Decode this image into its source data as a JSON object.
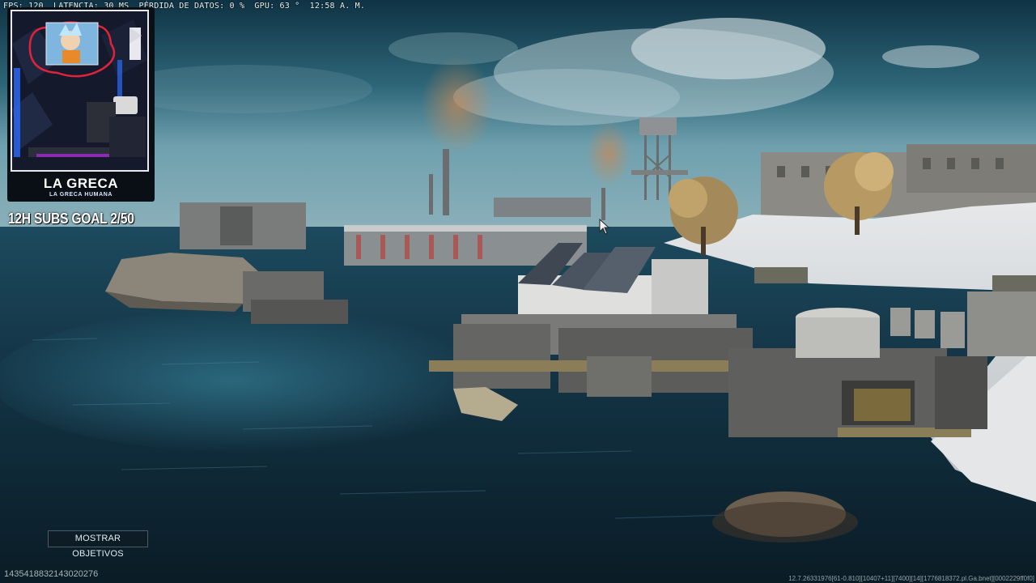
{
  "stats_bar": {
    "fps": "FPS: 120",
    "latency": "LATENCIA: 30 MS",
    "packet_loss": "PÉRDIDA DE DATOS: 0 %",
    "gpu": "GPU: 63 °",
    "time": "12:58 A. M."
  },
  "webcam": {
    "name": "LA GRECA",
    "tagline": "LA GRECA HUMANA",
    "icon": "webcam-feed"
  },
  "subs_goal": "12H SUBS GOAL 2/50",
  "objectives_button": "MOSTRAR OBJETIVOS",
  "session_id": "1435418832143020276",
  "build_info": "12.7.26331976[61-0.810][10407+11][7400][14][1776818372.pl.Ga.bnet][0002229ff0f0]",
  "colors": {
    "sky_top": "#123a4c",
    "sky_horizon": "#5f95a6",
    "water": "#0c2533",
    "snow": "#d9dde0",
    "concrete": "#6d6e6c",
    "neon_red": "#e0223a",
    "neon_blue": "#2a6bff"
  }
}
